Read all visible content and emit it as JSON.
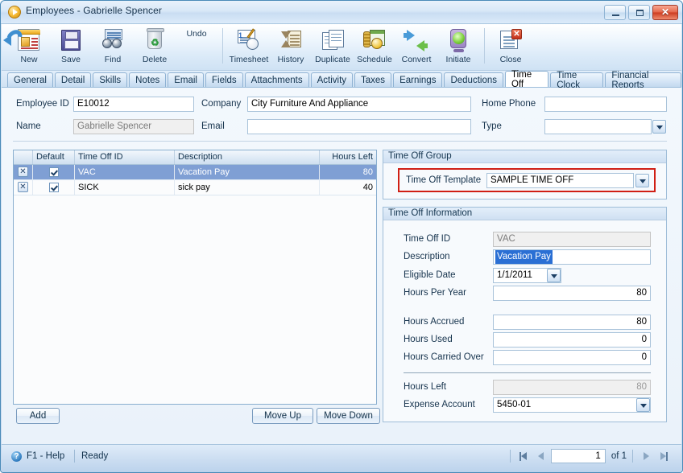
{
  "window": {
    "title": "Employees - Gabrielle Spencer",
    "app_icon": "play-circle-icon",
    "controls": {
      "minimize": "minimize-icon",
      "maximize": "maximize-icon",
      "close": "close-icon",
      "close_glyph": "✕"
    }
  },
  "toolbar": {
    "items": [
      {
        "label": "New",
        "icon": "new-record-icon"
      },
      {
        "label": "Save",
        "icon": "floppy-disk-icon"
      },
      {
        "label": "Find",
        "icon": "binoculars-icon"
      },
      {
        "label": "Delete",
        "icon": "recycle-bin-icon"
      },
      {
        "label": "Undo",
        "icon": "undo-arrow-icon"
      },
      {
        "label": "Timesheet",
        "icon": "timesheet-icon"
      },
      {
        "label": "History",
        "icon": "hourglass-history-icon"
      },
      {
        "label": "Duplicate",
        "icon": "duplicate-pages-icon"
      },
      {
        "label": "Schedule",
        "icon": "schedule-calendar-icon"
      },
      {
        "label": "Convert",
        "icon": "convert-arrows-icon"
      },
      {
        "label": "Initiate",
        "icon": "initiate-lamp-icon"
      },
      {
        "label": "Close",
        "icon": "close-document-icon"
      }
    ]
  },
  "tabs": {
    "items": [
      {
        "label": "General",
        "active": false
      },
      {
        "label": "Detail",
        "active": false
      },
      {
        "label": "Skills",
        "active": false
      },
      {
        "label": "Notes",
        "active": false
      },
      {
        "label": "Email",
        "active": false
      },
      {
        "label": "Fields",
        "active": false
      },
      {
        "label": "Attachments",
        "active": false
      },
      {
        "label": "Activity",
        "active": false
      },
      {
        "label": "Taxes",
        "active": false
      },
      {
        "label": "Earnings",
        "active": false
      },
      {
        "label": "Deductions",
        "active": false
      },
      {
        "label": "Time Off",
        "active": true
      },
      {
        "label": "Time Clock",
        "active": false
      },
      {
        "label": "Financial Reports",
        "active": false
      }
    ]
  },
  "header_form": {
    "employee_id_label": "Employee ID",
    "employee_id_value": "E10012",
    "name_label": "Name",
    "name_value": "Gabrielle Spencer",
    "company_label": "Company",
    "company_value": "City Furniture And Appliance",
    "email_label": "Email",
    "email_value": "",
    "home_phone_label": "Home Phone",
    "home_phone_value": "",
    "type_label": "Type",
    "type_value": "",
    "ellipsis_glyph": "•••"
  },
  "grid": {
    "columns": [
      "",
      "Default",
      "Time Off ID",
      "Description",
      "Hours Left"
    ],
    "rows": [
      {
        "delete": "✕",
        "default": true,
        "id": "VAC",
        "description": "Vacation Pay",
        "hours_left": "80",
        "selected": true
      },
      {
        "delete": "✕",
        "default": true,
        "id": "SICK",
        "description": "sick pay",
        "hours_left": "40",
        "selected": false
      }
    ],
    "buttons": {
      "add": "Add",
      "move_up": "Move Up",
      "move_down": "Move Down"
    }
  },
  "time_off_group": {
    "title": "Time Off Group",
    "template_label": "Time Off Template",
    "template_value": "SAMPLE TIME OFF",
    "highlight_color": "#d01f14"
  },
  "time_off_information": {
    "title": "Time Off Information",
    "fields": [
      {
        "label": "Time Off ID",
        "value": "VAC",
        "type": "readonly-text"
      },
      {
        "label": "Description",
        "value": "Vacation Pay",
        "type": "text-selected"
      },
      {
        "label": "Eligible Date",
        "value": "1/1/2011",
        "type": "date-dropdown"
      },
      {
        "label": "Hours Per Year",
        "value": "80",
        "type": "number"
      },
      {
        "label": "Hours Accrued",
        "value": "80",
        "type": "number"
      },
      {
        "label": "Hours Used",
        "value": "0",
        "type": "number"
      },
      {
        "label": "Hours Carried Over",
        "value": "0",
        "type": "number"
      },
      {
        "label": "Hours Left",
        "value": "80",
        "type": "readonly-number"
      },
      {
        "label": "Expense Account",
        "value": "5450-01",
        "type": "dropdown"
      }
    ]
  },
  "statusbar": {
    "help_icon": "question-mark-icon",
    "help_text": "F1 - Help",
    "status_text": "Ready",
    "nav": {
      "first_icon": "first-record-icon",
      "prev_icon": "previous-record-icon",
      "page_value": "1",
      "of_text": "of 1",
      "next_icon": "next-record-icon",
      "last_icon": "last-record-icon"
    }
  }
}
